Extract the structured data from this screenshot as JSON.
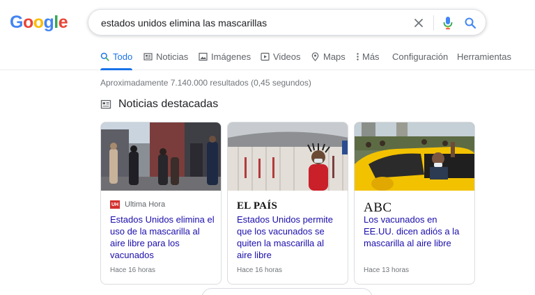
{
  "header": {
    "logo_letters": [
      {
        "char": "G",
        "color": "#4285F4"
      },
      {
        "char": "o",
        "color": "#EA4335"
      },
      {
        "char": "o",
        "color": "#FBBC05"
      },
      {
        "char": "g",
        "color": "#4285F4"
      },
      {
        "char": "l",
        "color": "#34A853"
      },
      {
        "char": "e",
        "color": "#EA4335"
      }
    ],
    "search_value": "estados unidos elimina las mascarillas",
    "icons": {
      "clear": "close-icon",
      "voice": "microphone-icon",
      "search": "search-icon"
    }
  },
  "nav": {
    "items": [
      {
        "label": "Todo",
        "icon": "search-icon",
        "active": true
      },
      {
        "label": "Noticias",
        "icon": "news-icon"
      },
      {
        "label": "Imágenes",
        "icon": "image-icon"
      },
      {
        "label": "Videos",
        "icon": "video-icon"
      },
      {
        "label": "Maps",
        "icon": "map-pin-icon"
      },
      {
        "label": "Más",
        "icon": "more-vert-icon"
      },
      {
        "label": "Configuración"
      },
      {
        "label": "Herramientas"
      }
    ]
  },
  "results": {
    "stats": "Aproximadamente 7.140.000 resultados (0,45 segundos)"
  },
  "top_stories": {
    "heading": "Noticias destacadas",
    "accent_link_color": "#1a0dab",
    "cards": [
      {
        "source": "Ultima Hora",
        "source_logo_text": "UH",
        "title": "Estados Unidos elimina el uso de la mascarilla al aire libre para los vacunados",
        "time": "Hace 16 horas"
      },
      {
        "source": "EL PAÍS",
        "title": "Estados Unidos permite que los vacunados se quiten la mascarilla al aire libre",
        "time": "Hace 16 horas"
      },
      {
        "source": "ABC",
        "title": "Los vacunados en EE.UU. dicen adiós a la mascarilla al aire libre",
        "time": "Hace 13 horas"
      }
    ]
  }
}
